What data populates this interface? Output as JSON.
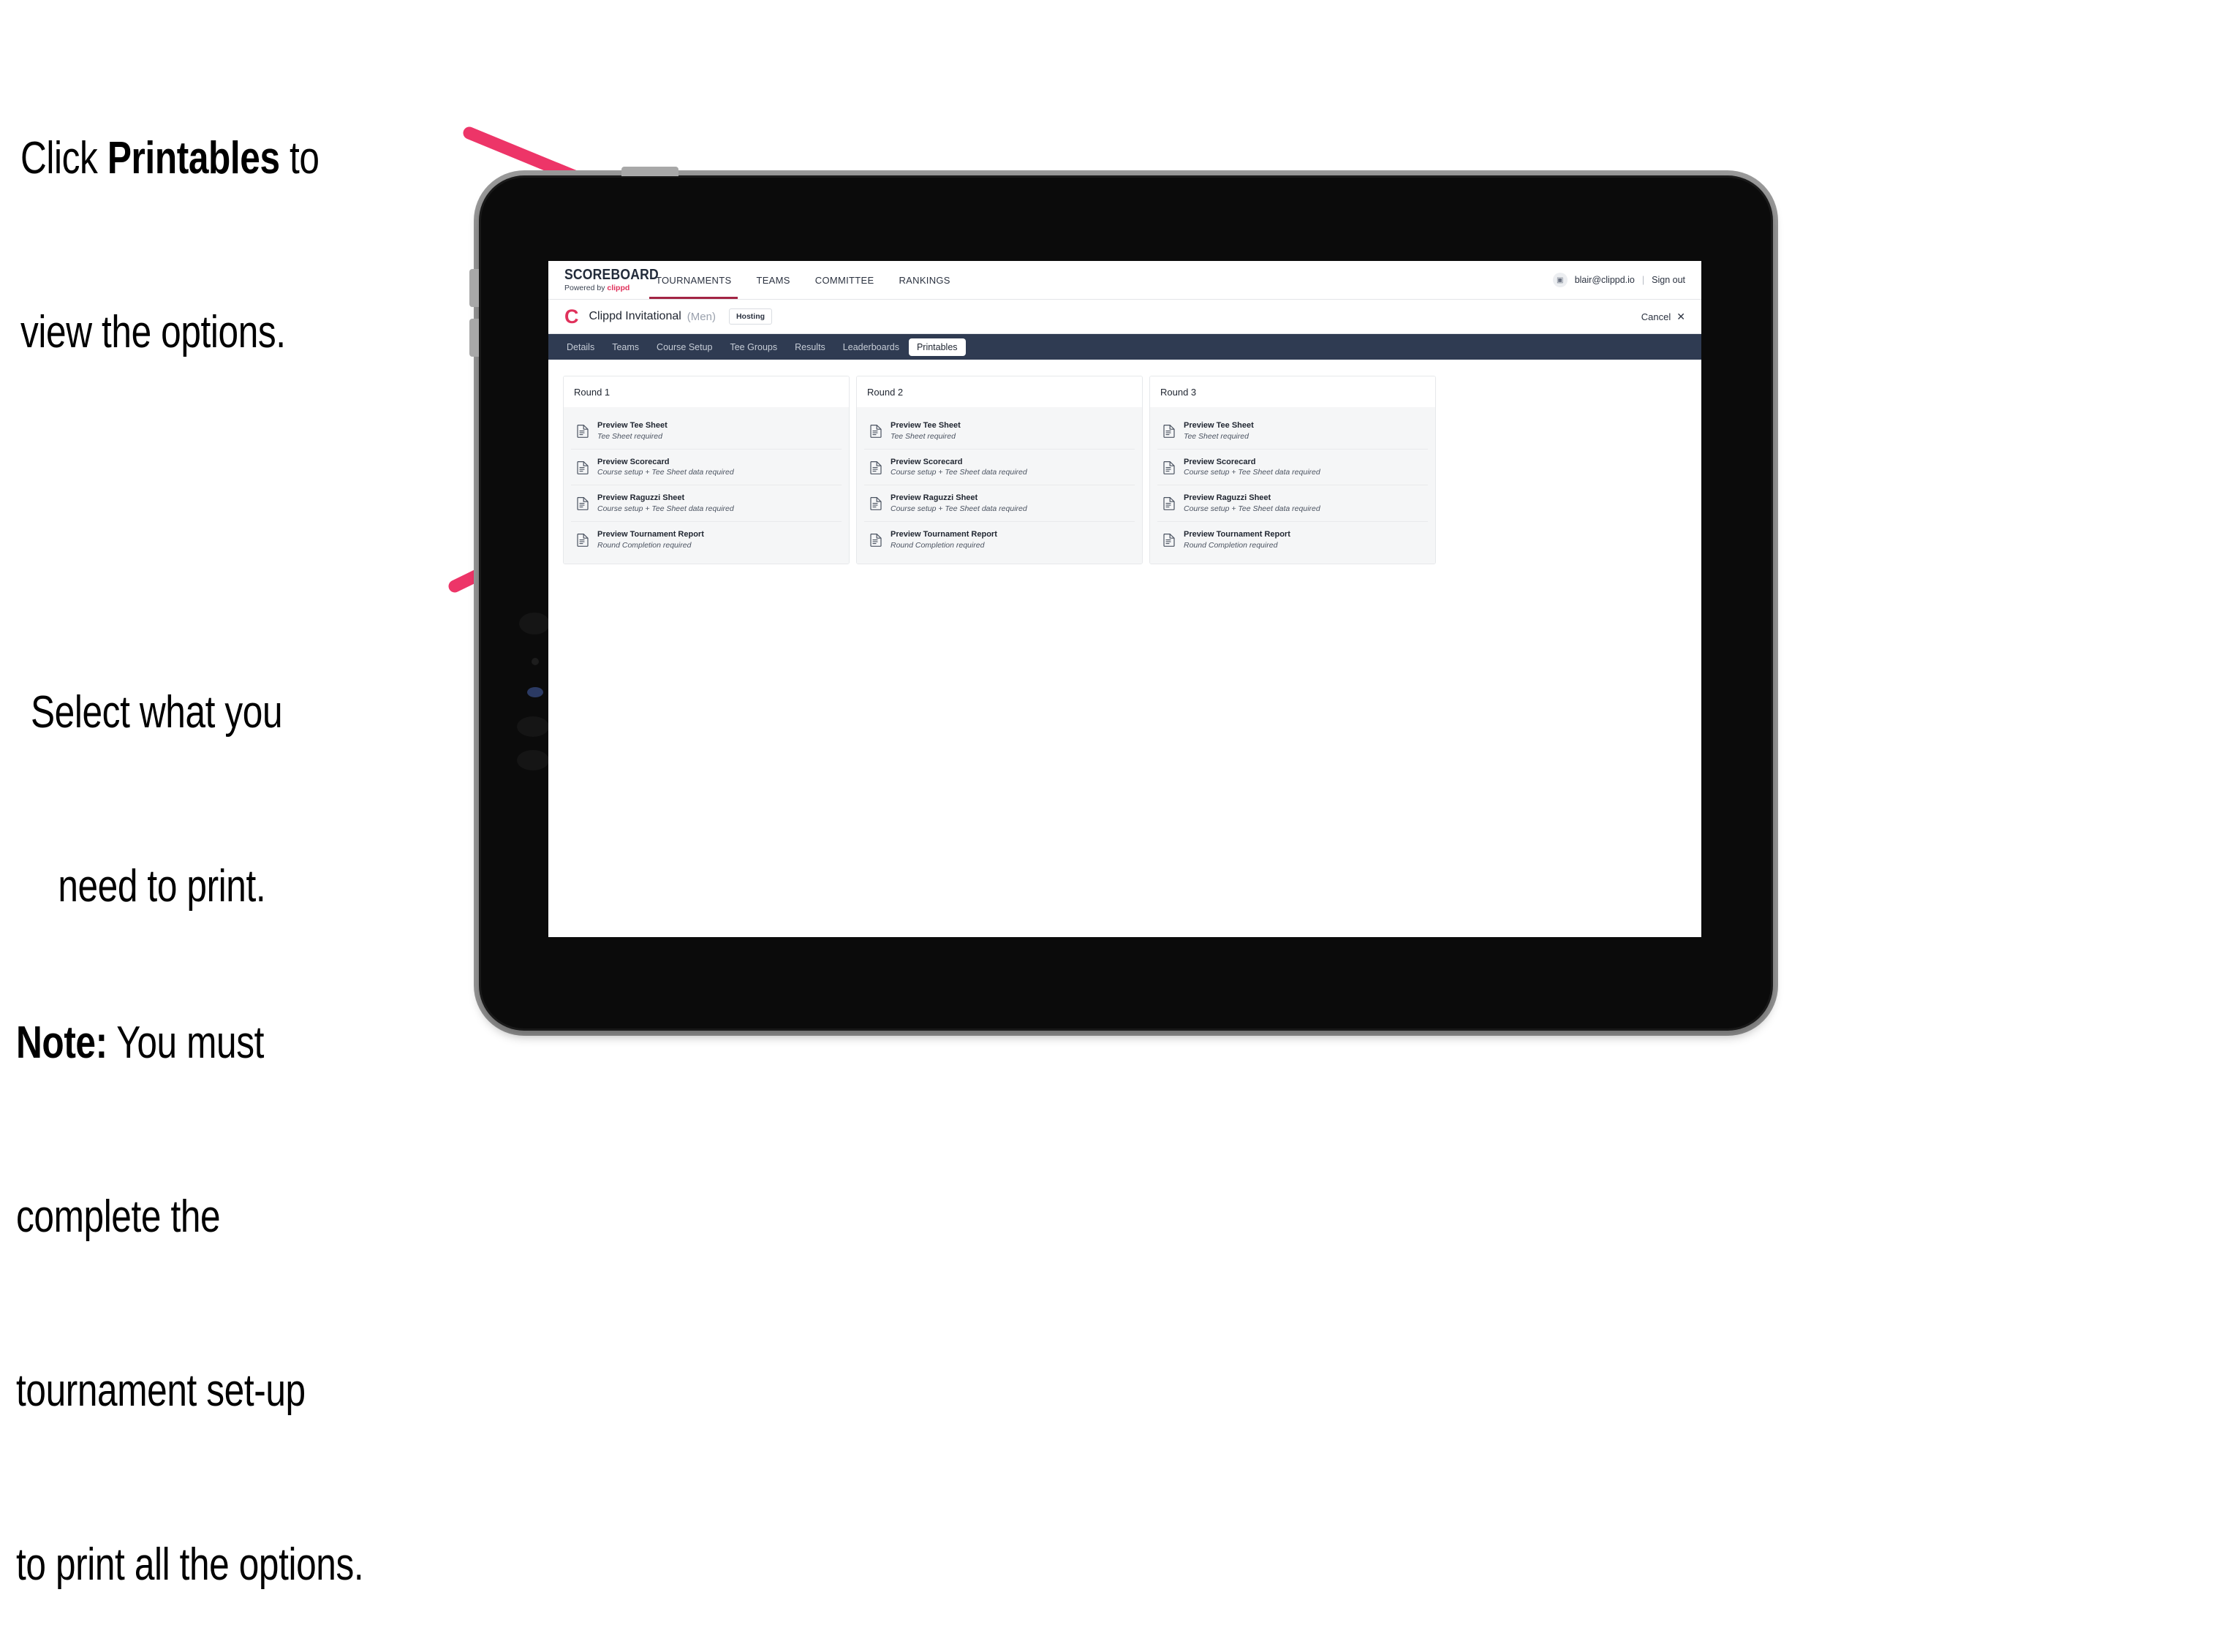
{
  "annotations": {
    "click_printables": {
      "line1_pre": "Click ",
      "line1_bold": "Printables",
      "line1_post": " to",
      "line2": "view the options."
    },
    "select_print": {
      "line1": "Select what you",
      "line2": "need to print."
    },
    "note": {
      "label": "Note:",
      "line1_rest": " You must",
      "line2": "complete the",
      "line3": "tournament set-up",
      "line4": "to print all the options."
    }
  },
  "colors": {
    "arrow": "#ed3568",
    "subnav_bg": "#2f3b52",
    "brand_pink": "#e0315b",
    "accent_underline": "#a32544"
  },
  "app": {
    "brand": {
      "title": "SCOREBOARD",
      "powered_prefix": "Powered by ",
      "powered_name": "clippd"
    },
    "main_nav": [
      {
        "label": "TOURNAMENTS",
        "active": true
      },
      {
        "label": "TEAMS",
        "active": false
      },
      {
        "label": "COMMITTEE",
        "active": false
      },
      {
        "label": "RANKINGS",
        "active": false
      }
    ],
    "account": {
      "avatar_glyph": "▣",
      "email": "blair@clippd.io",
      "separator": "|",
      "sign_out": "Sign out"
    },
    "title_row": {
      "logo_letter": "C",
      "tournament_name": "Clippd Invitational",
      "gender": "(Men)",
      "hosting_badge": "Hosting",
      "cancel_label": "Cancel",
      "cancel_icon": "✕"
    },
    "sub_nav": [
      {
        "label": "Details",
        "active": false
      },
      {
        "label": "Teams",
        "active": false
      },
      {
        "label": "Course Setup",
        "active": false
      },
      {
        "label": "Tee Groups",
        "active": false
      },
      {
        "label": "Results",
        "active": false
      },
      {
        "label": "Leaderboards",
        "active": false
      },
      {
        "label": "Printables",
        "active": true
      }
    ],
    "rounds": [
      {
        "title": "Round 1",
        "items": [
          {
            "title": "Preview Tee Sheet",
            "subtitle": "Tee Sheet required"
          },
          {
            "title": "Preview Scorecard",
            "subtitle": "Course setup + Tee Sheet data required"
          },
          {
            "title": "Preview Raguzzi Sheet",
            "subtitle": "Course setup + Tee Sheet data required"
          },
          {
            "title": "Preview Tournament Report",
            "subtitle": "Round Completion required"
          }
        ]
      },
      {
        "title": "Round 2",
        "items": [
          {
            "title": "Preview Tee Sheet",
            "subtitle": "Tee Sheet required"
          },
          {
            "title": "Preview Scorecard",
            "subtitle": "Course setup + Tee Sheet data required"
          },
          {
            "title": "Preview Raguzzi Sheet",
            "subtitle": "Course setup + Tee Sheet data required"
          },
          {
            "title": "Preview Tournament Report",
            "subtitle": "Round Completion required"
          }
        ]
      },
      {
        "title": "Round 3",
        "items": [
          {
            "title": "Preview Tee Sheet",
            "subtitle": "Tee Sheet required"
          },
          {
            "title": "Preview Scorecard",
            "subtitle": "Course setup + Tee Sheet data required"
          },
          {
            "title": "Preview Raguzzi Sheet",
            "subtitle": "Course setup + Tee Sheet data required"
          },
          {
            "title": "Preview Tournament Report",
            "subtitle": "Round Completion required"
          }
        ]
      }
    ]
  }
}
